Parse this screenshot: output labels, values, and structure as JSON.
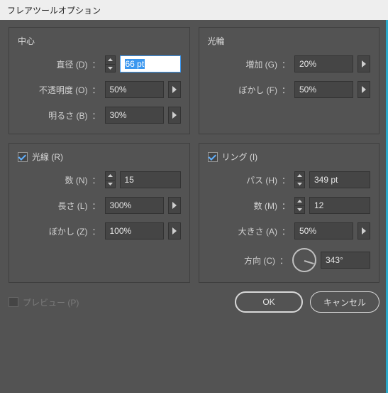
{
  "window": {
    "title": "フレアツールオプション"
  },
  "center": {
    "title": "中心",
    "diameter": {
      "label": "直径 (D)",
      "value": "66 pt"
    },
    "opacity": {
      "label": "不透明度 (O)",
      "value": "50%"
    },
    "brightness": {
      "label": "明るさ (B)",
      "value": "30%"
    }
  },
  "halo": {
    "title": "光輪",
    "growth": {
      "label": "増加 (G)",
      "value": "20%"
    },
    "blur": {
      "label": "ぼかし (F)",
      "value": "50%"
    }
  },
  "rays": {
    "title": "光線 (R)",
    "checked": true,
    "count": {
      "label": "数 (N)",
      "value": "15"
    },
    "length": {
      "label": "長さ (L)",
      "value": "300%"
    },
    "blur": {
      "label": "ぼかし (Z)",
      "value": "100%"
    }
  },
  "rings": {
    "title": "リング (I)",
    "checked": true,
    "path": {
      "label": "パス (H)",
      "value": "349 pt"
    },
    "count": {
      "label": "数 (M)",
      "value": "12"
    },
    "size": {
      "label": "大きさ (A)",
      "value": "50%"
    },
    "direction": {
      "label": "方向 (C)",
      "value": "343°",
      "angle": 343
    }
  },
  "preview": {
    "label": "プレビュー (P)",
    "checked": false,
    "disabled": true
  },
  "buttons": {
    "ok": "OK",
    "cancel": "キャンセル"
  }
}
